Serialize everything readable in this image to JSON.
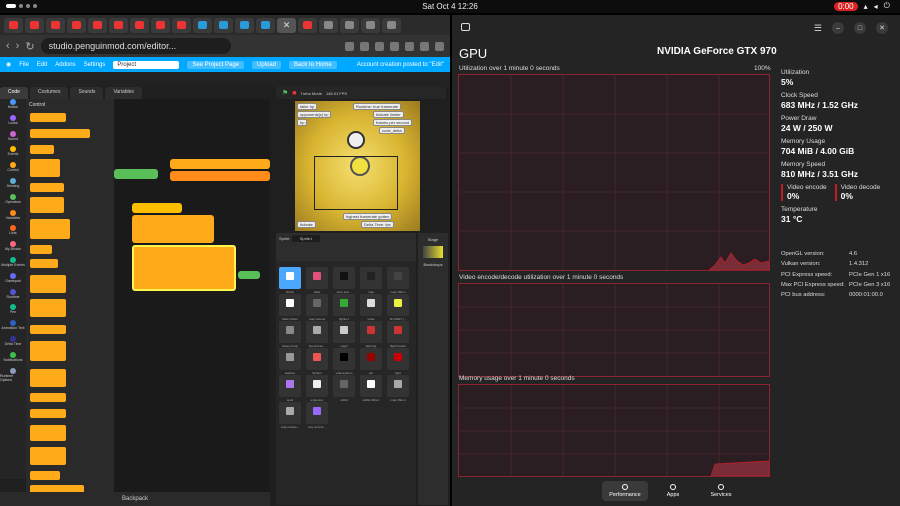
{
  "topbar": {
    "clock": "Sat Oct 4  12:26",
    "rec": "0:00"
  },
  "browser": {
    "url": "studio.penguinmod.com/editor...",
    "menu": [
      "File",
      "Edit",
      "Addons",
      "Settings"
    ],
    "project_name": "Project",
    "see_project_page": "See Project Page",
    "upload": "Upload",
    "back_home": "Back to Home",
    "account_notice": "Account creation posted to \"Edit\"",
    "editor_tabs": [
      "Code",
      "Costumes",
      "Sounds",
      "Variables"
    ],
    "palette_title": "Control",
    "categories": [
      {
        "label": "Motion",
        "color": "#4c97ff"
      },
      {
        "label": "Looks",
        "color": "#9966ff"
      },
      {
        "label": "Sound",
        "color": "#cf63cf"
      },
      {
        "label": "Events",
        "color": "#ffbf00"
      },
      {
        "label": "Control",
        "color": "#ffab19"
      },
      {
        "label": "Sensing",
        "color": "#5cb1d6"
      },
      {
        "label": "Operators",
        "color": "#59c059"
      },
      {
        "label": "Variables",
        "color": "#ff8c1a"
      },
      {
        "label": "Lists",
        "color": "#ff661a"
      },
      {
        "label": "My Blocks",
        "color": "#ff6680"
      },
      {
        "label": "Multiple Events",
        "color": "#0fbd8c"
      },
      {
        "label": "Gamepad",
        "color": "#6a6af0"
      },
      {
        "label": "Runtime",
        "color": "#5555cc"
      },
      {
        "label": "Pen",
        "color": "#0fbd8c"
      },
      {
        "label": "Animation Text",
        "color": "#3060c0"
      },
      {
        "label": "Delta Time",
        "color": "#333399"
      },
      {
        "label": "Notifications",
        "color": "#40bf4a"
      },
      {
        "label": "Runtime Options",
        "color": "#8c9abf"
      }
    ],
    "turbo": "Turbo Mode",
    "fps": "148.01 FPS",
    "monitors": [
      "taller hp",
      "opponents[x] hp",
      "hp",
      "Runtime: true framerate",
      "tickrate limiter",
      "frames per second",
      "code_delta",
      "highest framerate gotten",
      "tickrate",
      "Delta Time: fps"
    ],
    "sprite_label": "Sprite",
    "sprite_name": "Sprite1",
    "stage_label": "Stage",
    "backdrops_label": "Backdrops",
    "sprites": [
      "button",
      "table",
      "story and...",
      "map",
      "map ribbon",
      "table ribbon",
      "map volume",
      "fighter1",
      "smile",
      "FLOWEY j...",
      "flowey body",
      "big and de...",
      "map2",
      "fight big",
      "flight border",
      "slashes",
      "Sprite1",
      "videosystem",
      "act",
      "fight",
      "spell",
      "explosion",
      "rabbit",
      "rabbit ribbon",
      "map ribbon",
      "map retrace...",
      "buy current..."
    ],
    "backpack": "Backpack"
  },
  "monitor": {
    "title": "GPU",
    "gpu_name": "NVIDIA GeForce GTX 970",
    "graphs": [
      {
        "label": "Utilization over 1 minute 0 seconds",
        "max": "100%"
      },
      {
        "label": "Video encode/decode utilization over 1 minute 0 seconds",
        "max": ""
      },
      {
        "label": "Memory usage over 1 minute 0 seconds",
        "max": ""
      }
    ],
    "stats": [
      {
        "k": "Utilization",
        "v": "5%"
      },
      {
        "k": "Clock Speed",
        "v": "683 MHz / 1.52 GHz"
      },
      {
        "k": "Power Draw",
        "v": "24 W / 250 W"
      },
      {
        "k": "Memory Usage",
        "v": "704 MiB / 4.00 GiB"
      },
      {
        "k": "Memory Speed",
        "v": "810 MHz / 3.51 GHz"
      }
    ],
    "video_encode": {
      "k": "Video encode",
      "v": "0%"
    },
    "video_decode": {
      "k": "Video decode",
      "v": "0%"
    },
    "temperature": {
      "k": "Temperature",
      "v": "31 °C"
    },
    "info": [
      {
        "a": "OpenGL version:",
        "b": "4.6"
      },
      {
        "a": "Vulkan version:",
        "b": "1.4.312"
      },
      {
        "a": "PCI Express speed:",
        "b": "PCIe Gen 1 x16"
      },
      {
        "a": "Max PCI Express speed:",
        "b": "PCIe Gen 3 x16"
      },
      {
        "a": "PCI bus address:",
        "b": "0000:01:00.0"
      }
    ],
    "nav": [
      "Performance",
      "Apps",
      "Services"
    ],
    "accent": "#c01c28"
  }
}
